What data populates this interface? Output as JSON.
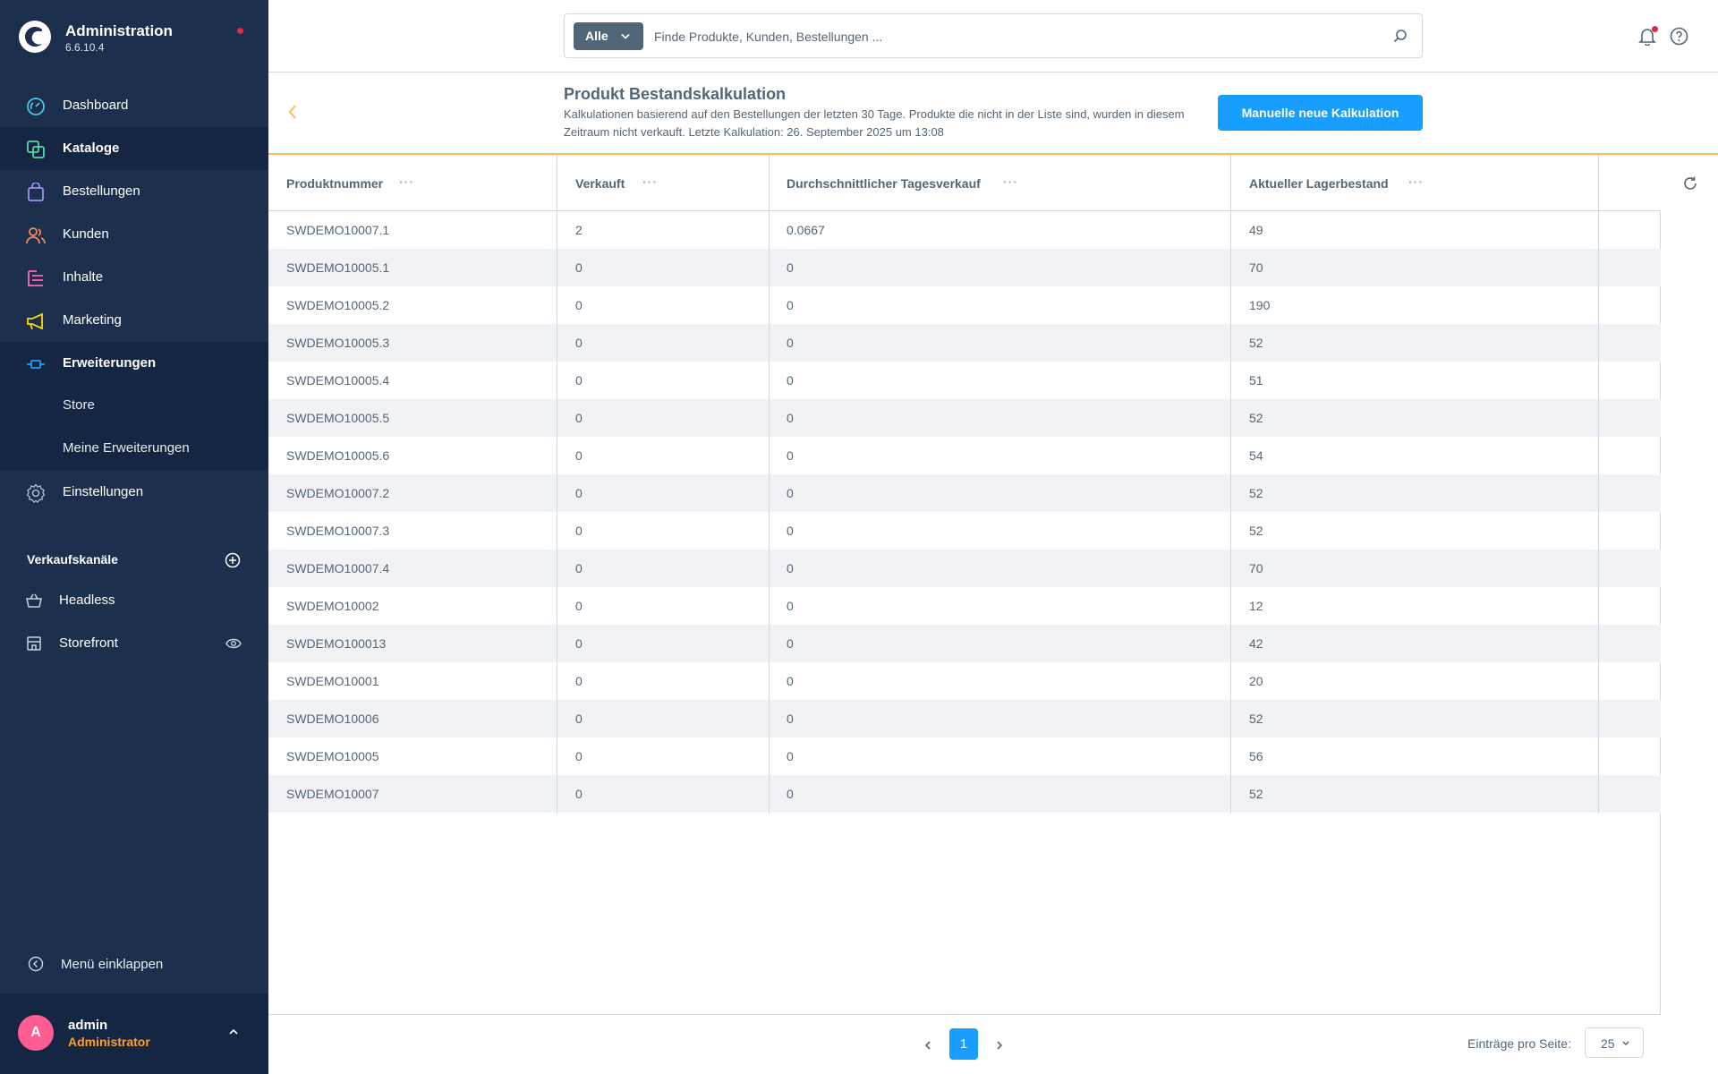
{
  "app": {
    "title": "Administration",
    "version": "6.6.10.4"
  },
  "sidebar": {
    "items": [
      {
        "label": "Dashboard",
        "icon": "gauge-icon"
      },
      {
        "label": "Kataloge",
        "icon": "catalog-icon",
        "active": true
      },
      {
        "label": "Bestellungen",
        "icon": "shopping-bag-icon"
      },
      {
        "label": "Kunden",
        "icon": "users-icon"
      },
      {
        "label": "Inhalte",
        "icon": "content-icon"
      },
      {
        "label": "Marketing",
        "icon": "megaphone-icon"
      },
      {
        "label": "Erweiterungen",
        "icon": "plug-icon"
      },
      {
        "label": "Einstellungen",
        "icon": "gear-icon"
      }
    ],
    "sub_items": [
      {
        "label": "Store"
      },
      {
        "label": "Meine Erweiterungen"
      }
    ],
    "sales_channels_title": "Verkaufskanäle",
    "channels": [
      {
        "label": "Headless"
      },
      {
        "label": "Storefront"
      }
    ],
    "collapse_label": "Menü einklappen",
    "user": {
      "initial": "A",
      "name": "admin",
      "role": "Administrator"
    }
  },
  "search": {
    "type_label": "Alle",
    "placeholder": "Finde Produkte, Kunden, Bestellungen ..."
  },
  "header": {
    "title": "Produkt Bestandskalkulation",
    "description": "Kalkulationen basierend auf den Bestellungen der letzten 30 Tage. Produkte die nicht in der Liste sind, wurden in diesem Zeitraum nicht verkauft. Letzte Kalkulation: 26. September 2025 um 13:08",
    "button_label": "Manuelle neue Kalkulation"
  },
  "table": {
    "columns": [
      "Produktnummer",
      "Verkauft",
      "Durchschnittlicher Tagesverkauf",
      "Aktueller Lagerbestand"
    ],
    "column_menu": "···",
    "rows": [
      [
        "SWDEMO10007.1",
        "2",
        "0.0667",
        "49"
      ],
      [
        "SWDEMO10005.1",
        "0",
        "0",
        "70"
      ],
      [
        "SWDEMO10005.2",
        "0",
        "0",
        "190"
      ],
      [
        "SWDEMO10005.3",
        "0",
        "0",
        "52"
      ],
      [
        "SWDEMO10005.4",
        "0",
        "0",
        "51"
      ],
      [
        "SWDEMO10005.5",
        "0",
        "0",
        "52"
      ],
      [
        "SWDEMO10005.6",
        "0",
        "0",
        "54"
      ],
      [
        "SWDEMO10007.2",
        "0",
        "0",
        "52"
      ],
      [
        "SWDEMO10007.3",
        "0",
        "0",
        "52"
      ],
      [
        "SWDEMO10007.4",
        "0",
        "0",
        "70"
      ],
      [
        "SWDEMO10002",
        "0",
        "0",
        "12"
      ],
      [
        "SWDEMO100013",
        "0",
        "0",
        "42"
      ],
      [
        "SWDEMO10001",
        "0",
        "0",
        "20"
      ],
      [
        "SWDEMO10006",
        "0",
        "0",
        "52"
      ],
      [
        "SWDEMO10005",
        "0",
        "0",
        "56"
      ],
      [
        "SWDEMO10007",
        "0",
        "0",
        "52"
      ]
    ]
  },
  "pagination": {
    "current_page": "1",
    "per_page_label": "Einträge pro Seite:",
    "per_page_value": "25"
  },
  "colors": {
    "sidebar": "#1c2f4d",
    "accent": "#189eff",
    "warning_line": "#ffb75d",
    "notification": "#de294c",
    "avatar": "#ff5c94",
    "role": "#ff9f2e"
  }
}
